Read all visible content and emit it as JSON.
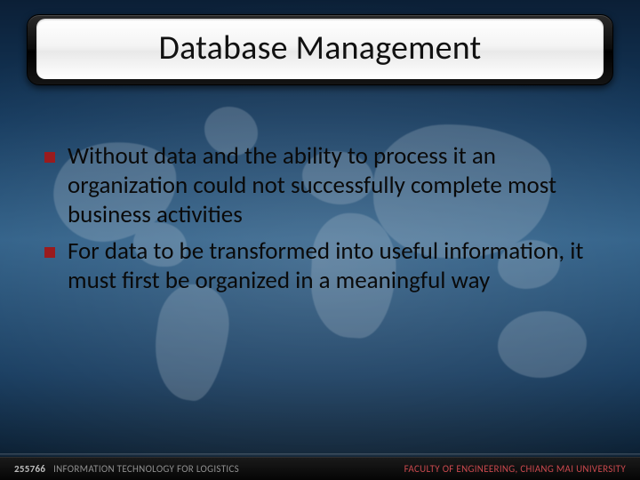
{
  "title": "Database Management",
  "bullets": [
    "Without data and the ability to process it an organization could not successfully complete most business activities",
    "For data to be transformed into useful information, it must first be organized in a meaningful way"
  ],
  "footer": {
    "course_code": "255766",
    "course_name": "INFORMATION TECHNOLOGY FOR LOGISTICS",
    "right": "FACULTY OF ENGINEERING, CHIANG MAI UNIVERSITY"
  }
}
